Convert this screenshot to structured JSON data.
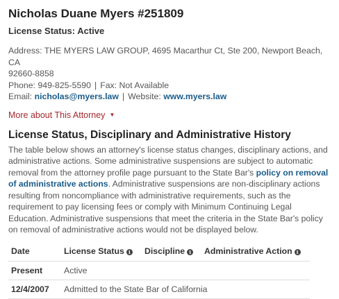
{
  "attorney": {
    "name": "Nicholas Duane Myers #251809",
    "license_status": "License Status: Active"
  },
  "contact": {
    "address_label": "Address:",
    "address_line1": "THE MYERS LAW GROUP, 4695 Macarthur Ct, Ste 200, Newport Beach, CA",
    "address_line2": "92660-8858",
    "phone": "Phone: 949-825-5590",
    "fax": "Fax: Not Available",
    "email_label": "Email:",
    "email": "nicholas@myers.law",
    "website_label": "Website:",
    "website": "www.myers.law",
    "separator": "|"
  },
  "more_link": {
    "label": "More about This Attorney",
    "icon": "caret-down-icon"
  },
  "history": {
    "title": "License Status, Disciplinary and Administrative History",
    "desc_part1": "The table below shows an attorney's license status changes, disciplinary actions, and administrative actions. Some administrative suspensions are subject to automatic removal from the attorney profile page pursuant to the State Bar's",
    "desc_link": "policy on removal of administrative actions",
    "desc_part2": ". Administrative suspensions are non-disciplinary actions resulting from noncompliance with administrative requirements, such as the requirement to pay licensing fees or comply with Minimum Continuing Legal Education. Administrative suspensions that meet the criteria in the State Bar's policy on removal of administrative actions would not be displayed below.",
    "columns": [
      "Date",
      "License Status",
      "Discipline",
      "Administrative Action"
    ],
    "rows": [
      {
        "date": "Present",
        "text": "Active"
      },
      {
        "date": "12/4/2007",
        "text": "Admitted to the State Bar of California"
      }
    ]
  },
  "colors": {
    "link": "#1a5c8a",
    "more_link": "#a3282d",
    "heading": "#222222",
    "body_text": "#555555"
  }
}
